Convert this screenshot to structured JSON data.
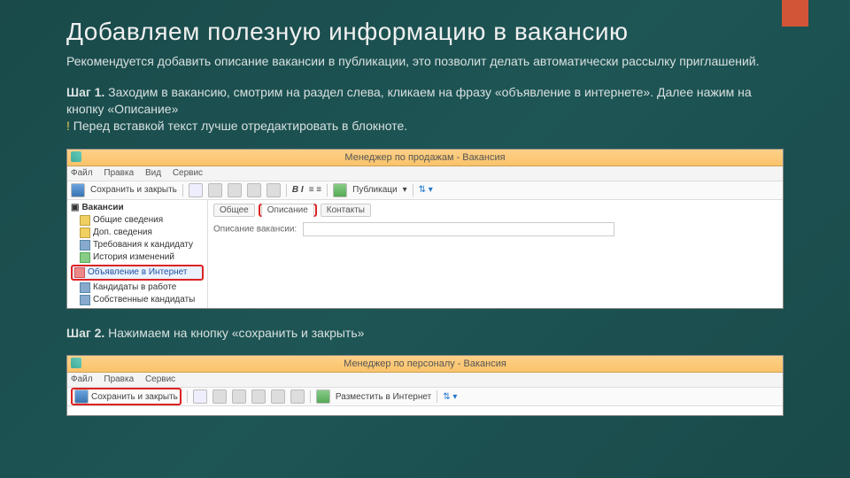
{
  "slide": {
    "title": "Добавляем полезную информацию в вакансию",
    "intro": "Рекомендуется добавить описание вакансии в публикации, это позволит делать автоматически рассылку приглашений.",
    "step1_label": "Шаг 1.",
    "step1_text": " Заходим в вакансию, смотрим на раздел слева, кликаем на фразу «объявление в интернете». Далее нажим на кнопку «Описание»",
    "step1_warn_mark": "!",
    "step1_warn": " Перед вставкой текст лучше отредактировать в блокноте.",
    "step2_label": "Шаг 2.",
    "step2_text": " Нажимаем на кнопку «сохранить и закрыть»"
  },
  "shot1": {
    "title": "Менеджер по продажам - Вакансия",
    "menu": [
      "Файл",
      "Правка",
      "Вид",
      "Сервис"
    ],
    "save_close": "Сохранить и закрыть",
    "publish": "Публикаци",
    "tree_root": "Вакансии",
    "tree": [
      "Общие сведения",
      "Доп. сведения",
      "Требования к кандидату",
      "История изменений"
    ],
    "tree_hl": "Объявление в Интернет",
    "tree_after": [
      "Кандидаты в работе",
      "Собственные кандидаты"
    ],
    "tab1": "Общее",
    "tab2": "Описание",
    "tab3": "Контакты",
    "field_label": "Описание вакансии:"
  },
  "shot2": {
    "title": "Менеджер по персоналу - Вакансия",
    "menu": [
      "Файл",
      "Правка",
      "Сервис"
    ],
    "save_close": "Сохранить и закрыть",
    "publish": "Разместить в Интернет"
  }
}
